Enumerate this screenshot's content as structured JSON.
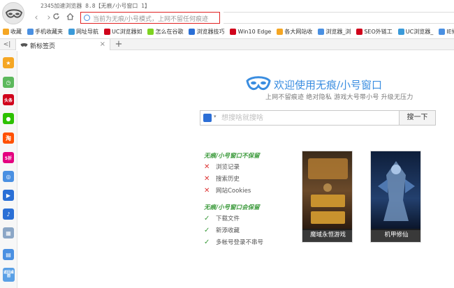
{
  "window": {
    "title": "2345加速浏览器 8.8【无痕/小号窗口 1】"
  },
  "nav": {
    "address_placeholder": "当前为无痕/小号模式，上网不留任何痕迹"
  },
  "bookmarks": [
    {
      "label": "收藏",
      "color": "#f5a623"
    },
    {
      "label": "手机收藏夹",
      "color": "#4a90e2"
    },
    {
      "label": "网址导航",
      "color": "#3a9ad9"
    },
    {
      "label": "UC浏览器如",
      "color": "#d0021b"
    },
    {
      "label": "怎么在谷歌",
      "color": "#7ed321"
    },
    {
      "label": "浏览器技巧",
      "color": "#2a6fd6"
    },
    {
      "label": "Win10 Edge",
      "color": "#d0021b"
    },
    {
      "label": "各大网站收",
      "color": "#f5a623"
    },
    {
      "label": "浏览器_浏",
      "color": "#4a90e2"
    },
    {
      "label": "SEO外链工",
      "color": "#d0021b"
    },
    {
      "label": "UC浏览器_",
      "color": "#3a9ad9"
    },
    {
      "label": "IE修复 - I",
      "color": "#4a90e2"
    }
  ],
  "tabs": {
    "active_label": "新标签页",
    "close_glyph": "×",
    "new_glyph": "+",
    "toggle_glyph": "<|"
  },
  "sidebar": [
    {
      "name": "favorites-star-icon",
      "color": "#f5a623",
      "glyph": "★"
    },
    {
      "name": "history-clock-icon",
      "color": "#5cb85c",
      "glyph": "◷"
    },
    {
      "name": "toutiao-icon",
      "color": "#d0021b",
      "glyph": "头条"
    },
    {
      "name": "wechat-icon",
      "color": "#2dc100",
      "glyph": "●"
    },
    {
      "name": "taobao-icon",
      "color": "#ff5000",
      "glyph": "淘"
    },
    {
      "name": "shopping-5zhe-icon",
      "color": "#e4007f",
      "glyph": "5折"
    },
    {
      "name": "game-controller-icon",
      "color": "#4a90e2",
      "glyph": "◎"
    },
    {
      "name": "video-film-icon",
      "color": "#2a6fd6",
      "glyph": "▶"
    },
    {
      "name": "music-note-icon",
      "color": "#2a6fd6",
      "glyph": "♪"
    },
    {
      "name": "calculator-icon",
      "color": "#8ba6c6",
      "glyph": "▦"
    },
    {
      "name": "notes-book-icon",
      "color": "#4a90e2",
      "glyph": "▤"
    },
    {
      "name": "back-to-desktop-icon",
      "color": "#5aa0e6",
      "glyph": "返回桌面"
    }
  ],
  "welcome": {
    "title": "欢迎使用无痕/小号窗口",
    "subtitle": "上网不留痕迹  绝对隐私  游戏大号带小号 升级无压力"
  },
  "search": {
    "placeholder": "想搜啥就搜啥",
    "button_label": "搜一下"
  },
  "not_saved": {
    "heading": "无痕/小号窗口不保留",
    "items": [
      "浏览记录",
      "搜索历史",
      "网站Cookies"
    ],
    "mark": "✕"
  },
  "saved": {
    "heading": "无痕/小号窗口会保留",
    "items": [
      "下载文件",
      "新添收藏",
      "多帐号登录不串号"
    ],
    "mark": "✓"
  },
  "games": [
    {
      "label": "魔域永恒游戏"
    },
    {
      "label": "机甲修仙"
    }
  ]
}
